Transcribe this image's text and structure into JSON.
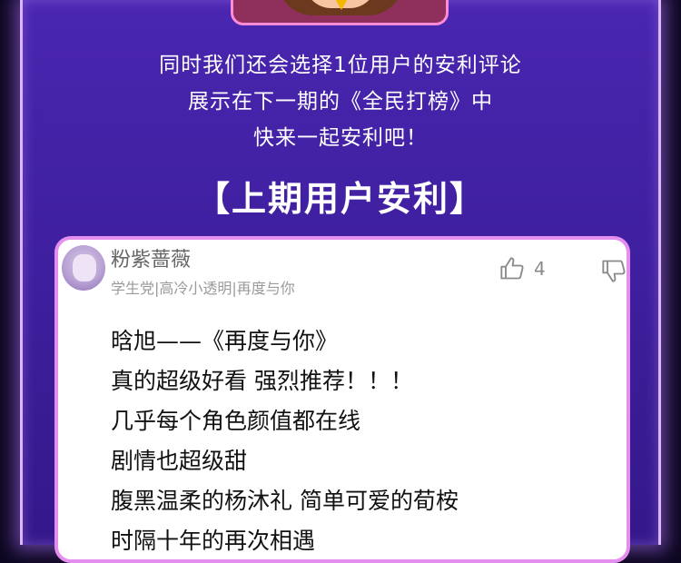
{
  "intro_lines": [
    "同时我们还会选择1位用户的安利评论",
    "展示在下一期的《全民打榜》中",
    "快来一起安利吧！"
  ],
  "section_title": "【上期用户安利】",
  "comment": {
    "username": "粉紫蔷薇",
    "tags": "学生党|高冷小透明|再度与你",
    "like_count": "4",
    "icons": {
      "like": "thumbs-up-icon",
      "dislike": "thumbs-down-icon"
    },
    "lines": [
      "晗旭——《再度与你》",
      "真的超级好看 强烈推荐！！！",
      "几乎每个角色颜值都在线",
      "剧情也超级甜",
      "腹黑温柔的杨沐礼 简单可爱的荀桉",
      "时隔十年的再次相遇"
    ]
  },
  "colors": {
    "background": "#0d0720",
    "panel": "#4a26b0",
    "panel_glow": "#d9b8ff",
    "card_border": "#e48ef0",
    "avatar_border": "#ff8ad8"
  }
}
